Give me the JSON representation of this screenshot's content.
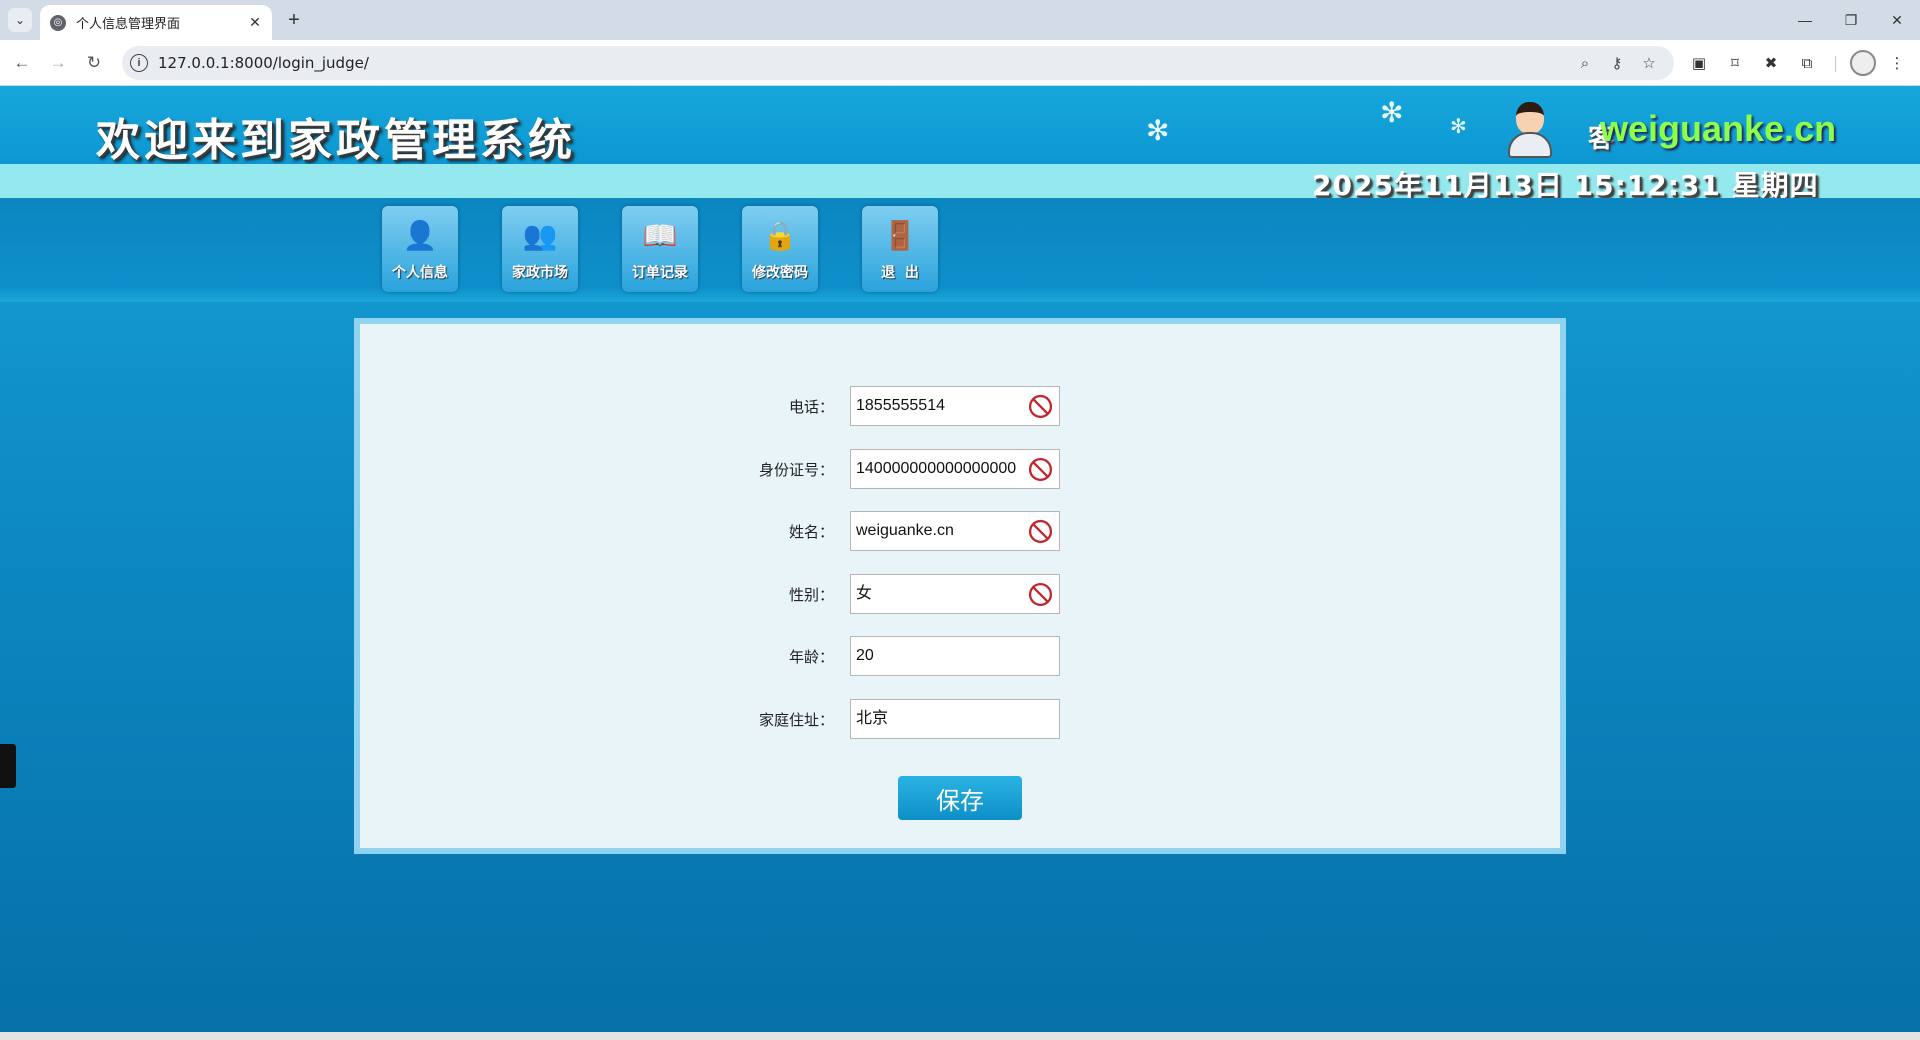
{
  "browser": {
    "tab_title": "个人信息管理界面",
    "url": "127.0.0.1:8000/login_judge/",
    "new_tab_label": "+",
    "close_tab_label": "✕"
  },
  "header": {
    "site_title": "欢迎来到家政管理系统",
    "guest_label": "客",
    "watermark": "weiguanke.cn",
    "datetime": "2025年11月13日 15:12:31 星期四"
  },
  "nav": {
    "items": [
      {
        "label": "个人信息",
        "icon": "person-icon"
      },
      {
        "label": "家政市场",
        "icon": "people-icon"
      },
      {
        "label": "订单记录",
        "icon": "order-book-icon"
      },
      {
        "label": "修改密码",
        "icon": "lock-person-icon"
      },
      {
        "label": "退  出",
        "icon": "exit-icon"
      }
    ]
  },
  "form": {
    "phone": {
      "label": "电话：",
      "value": "1855555514",
      "disabled": true
    },
    "id_number": {
      "label": "身份证号：",
      "value": "140000000000000000",
      "disabled": true
    },
    "name": {
      "label": "姓名：",
      "value": "weiguanke.cn",
      "disabled": true
    },
    "gender": {
      "label": "性别：",
      "value": "女",
      "disabled": true
    },
    "age": {
      "label": "年龄：",
      "value": "20",
      "disabled": false
    },
    "address": {
      "label": "家庭住址：",
      "value": "北京",
      "disabled": false
    },
    "save_label": "保存"
  },
  "colors": {
    "accent": "#0d8fc8",
    "banner": "#17a7db",
    "timebar": "#94e9ef",
    "ban_icon": "#c0272d"
  }
}
